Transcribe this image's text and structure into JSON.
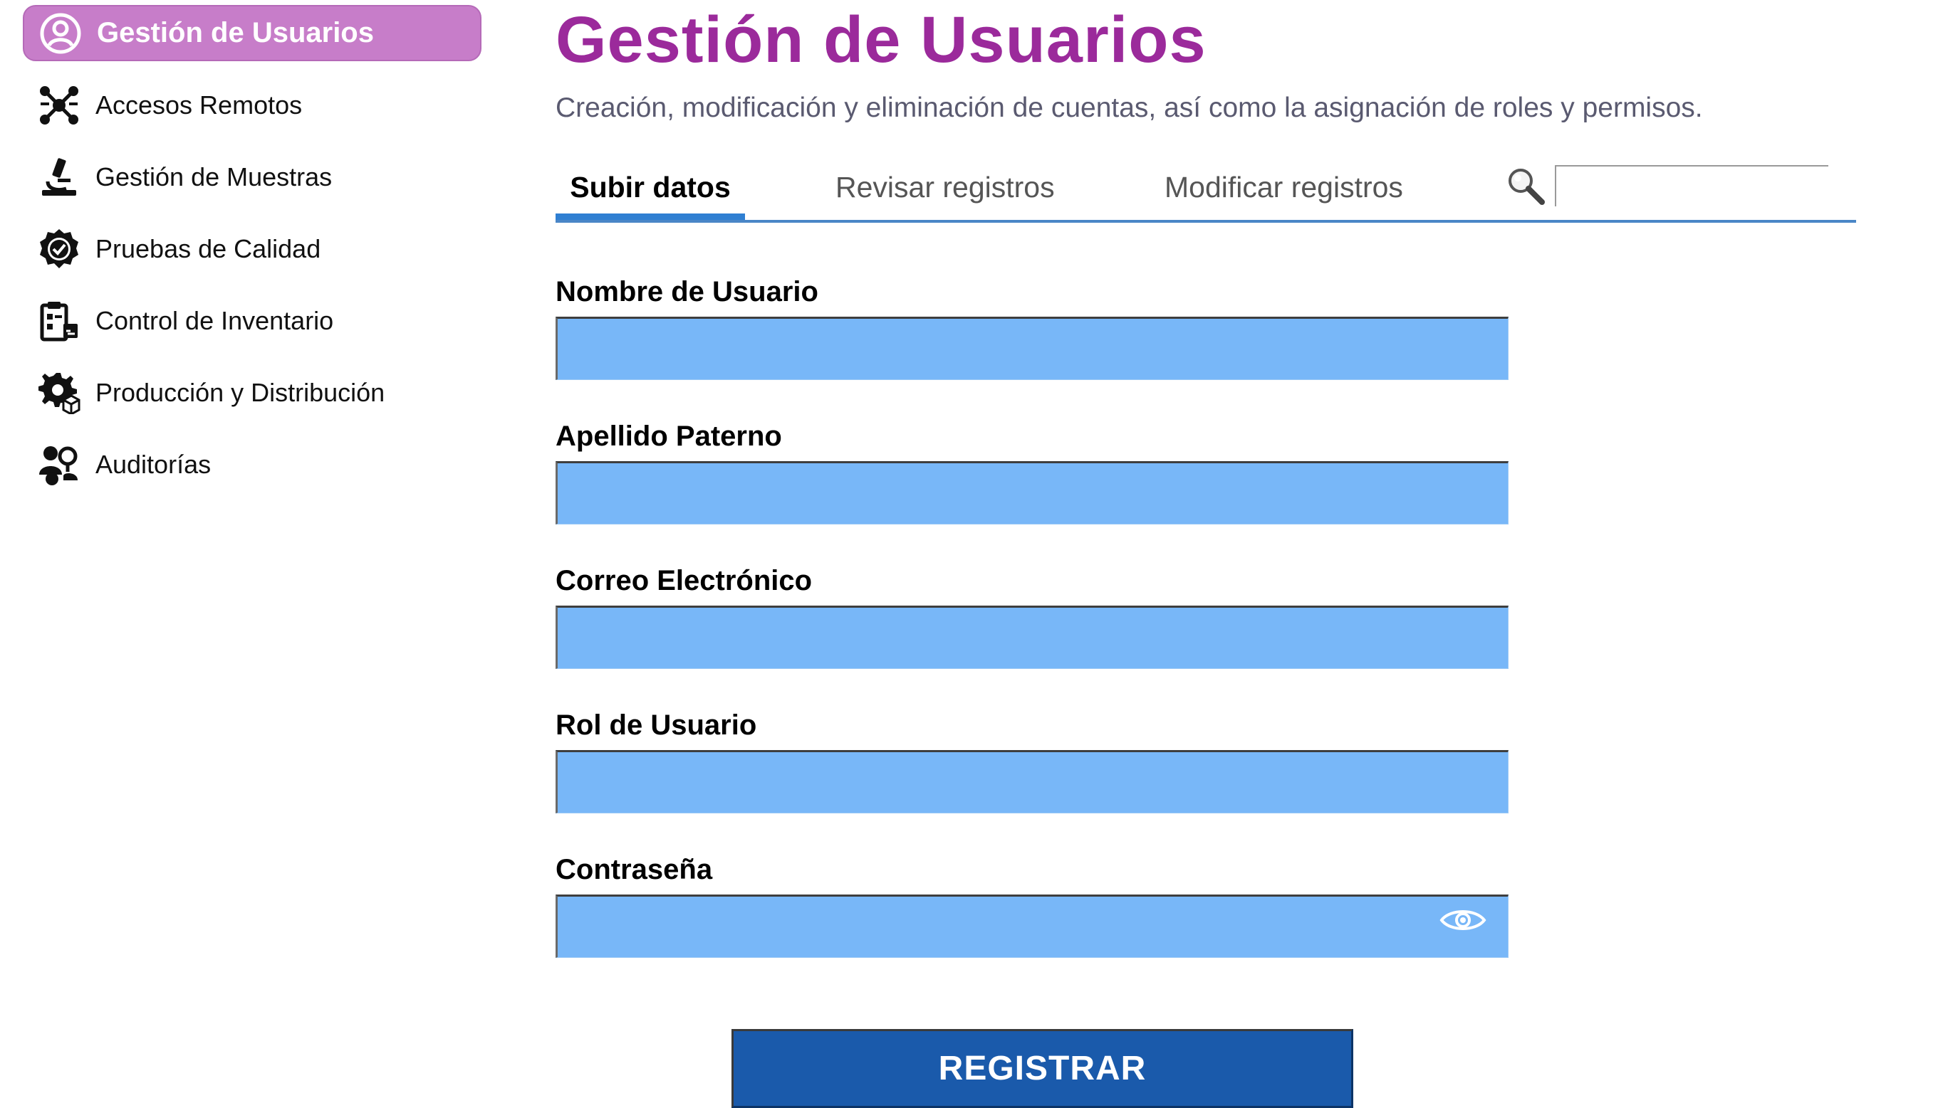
{
  "sidebar": {
    "items": [
      {
        "label": "Gestión de Usuarios",
        "icon": "user-circle-icon",
        "active": true
      },
      {
        "label": "Accesos Remotos",
        "icon": "network-nodes-icon",
        "active": false
      },
      {
        "label": "Gestión de Muestras",
        "icon": "microscope-icon",
        "active": false
      },
      {
        "label": "Pruebas de Calidad",
        "icon": "quality-badge-icon",
        "active": false
      },
      {
        "label": "Control de Inventario",
        "icon": "inventory-clipboard-icon",
        "active": false
      },
      {
        "label": "Producción y Distribución",
        "icon": "gear-package-icon",
        "active": false
      },
      {
        "label": "Auditorías",
        "icon": "audit-people-icon",
        "active": false
      }
    ]
  },
  "header": {
    "title": "Gestión de Usuarios",
    "subtitle": "Creación, modificación y eliminación de cuentas, así como la asignación de roles y permisos."
  },
  "tabs": [
    {
      "label": "Subir datos",
      "active": true
    },
    {
      "label": "Revisar registros",
      "active": false
    },
    {
      "label": "Modificar registros",
      "active": false
    }
  ],
  "search": {
    "value": "",
    "icon": "search-icon"
  },
  "form": {
    "fields": [
      {
        "label": "Nombre de Usuario",
        "value": ""
      },
      {
        "label": "Apellido Paterno",
        "value": ""
      },
      {
        "label": "Correo Electrónico",
        "value": ""
      },
      {
        "label": "Rol de Usuario",
        "value": ""
      },
      {
        "label": "Contraseña",
        "value": "",
        "icon": "eye-icon"
      }
    ],
    "submit_label": "REGISTRAR"
  },
  "colors": {
    "title": "#9b2a9b",
    "active_nav": "#c77dc9",
    "input_fill": "#78b7f8",
    "tab_underline": "#2f7fd2",
    "button": "#1a5aab"
  }
}
